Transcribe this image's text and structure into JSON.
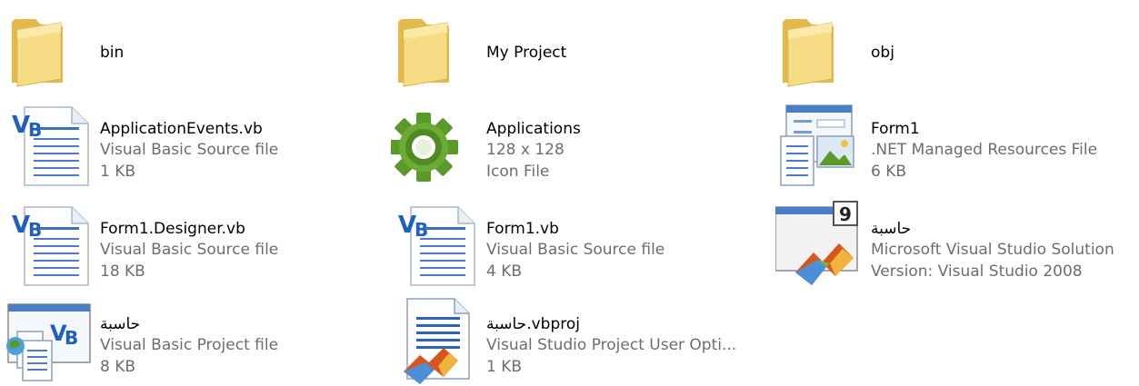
{
  "items": [
    {
      "name": "bin"
    },
    {
      "name": "My Project"
    },
    {
      "name": "obj"
    },
    {
      "name": "ApplicationEvents.vb",
      "line2": "Visual Basic Source file",
      "line3": "1 KB",
      "icon": "vb-source-icon"
    },
    {
      "name": "Applications",
      "line2": "128 x 128",
      "line3": "Icon File",
      "icon": "gear-icon"
    },
    {
      "name": "Form1",
      "line2": ".NET Managed Resources File",
      "line3": "6 KB",
      "icon": "resources-file-icon"
    },
    {
      "name": "Form1.Designer.vb",
      "line2": "Visual Basic Source file",
      "line3": "18 KB",
      "icon": "vb-source-icon"
    },
    {
      "name": "Form1.vb",
      "line2": "Visual Basic Source file",
      "line3": "4 KB",
      "icon": "vb-source-icon"
    },
    {
      "name": "حاسبة",
      "line2": "Microsoft Visual Studio Solution",
      "line3": "Version: Visual Studio 2008",
      "icon": "vs-solution-icon",
      "badge": "9"
    },
    {
      "name": "حاسبة",
      "line2": "Visual Basic Project file",
      "line3": "8 KB",
      "icon": "vb-project-icon"
    },
    {
      "name": "حاسبة.vbproj",
      "line2": "Visual Studio Project User Opti...",
      "line3": "1 KB",
      "icon": "vs-user-options-icon"
    }
  ],
  "colors": {
    "folder": "#f3d775",
    "vb_blue": "#1f5fbf",
    "gear_green": "#5b9a2a",
    "secondary_text": "#6d6d6d"
  }
}
